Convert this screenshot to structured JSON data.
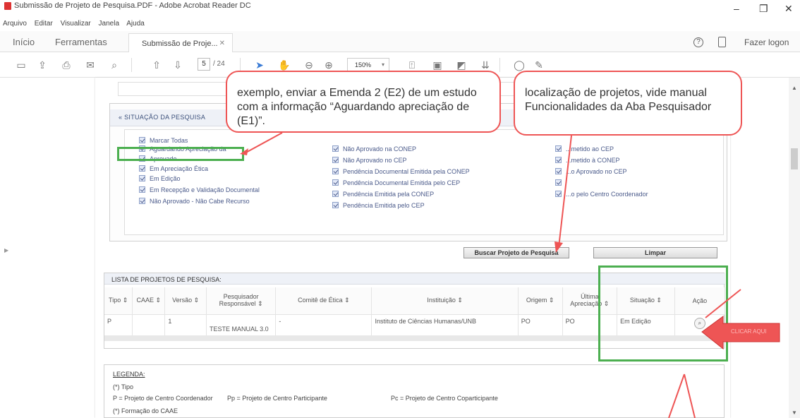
{
  "window": {
    "title": "Submissão de Projeto de Pesquisa.PDF - Adobe Acrobat Reader DC",
    "menu": [
      "Arquivo",
      "Editar",
      "Visualizar",
      "Janela",
      "Ajuda"
    ],
    "minimize": "–",
    "maximize": "❐",
    "close": "✕"
  },
  "tabs": {
    "home": "Início",
    "tools": "Ferramentas",
    "doc": "Submissão de Proje...",
    "close": "✕",
    "help": "?",
    "login": "Fazer logon"
  },
  "toolbar": {
    "page": "5",
    "page_count": "/ 24",
    "zoom": "150%"
  },
  "status_section": {
    "header": "SITUAÇÃO DA PESQUISA",
    "col1": [
      "Marcar Todas",
      "Aguardando Apreciação da",
      "Aprovado",
      "Em Apreciação Ética",
      "Em Edição",
      "Em Recepção e Validação Documental",
      "Não Aprovado - Não Cabe Recurso"
    ],
    "col2": [
      "Não Aprovado na CONEP",
      "Não Aprovado no CEP",
      "Pendência Documental Emitida pela CONEP",
      "Pendência Documental Emitida pelo CEP",
      "Pendência Emitida pela CONEP",
      "Pendência Emitida pelo CEP"
    ],
    "col3": [
      "...metido ao CEP",
      "...metido à CONEP",
      "...o Aprovado no CEP",
      "",
      "...o pelo Centro Coordenador"
    ],
    "search_btn": "Buscar Projeto de Pesquisa",
    "clear_btn": "Limpar"
  },
  "project_list": {
    "title": "LISTA DE PROJETOS DE PESQUISA:",
    "headers": [
      "Tipo ⇕",
      "CAAE ⇕",
      "Versão ⇕",
      "Pesquisador Responsável ⇕",
      "Comitê de Ética ⇕",
      "Instituição ⇕",
      "Origem ⇕",
      "Última Apreciação ⇕",
      "Situação ⇕",
      "Ação"
    ],
    "rows": [
      [
        "P",
        "",
        "1",
        "TESTE MANUAL 3.0",
        "-",
        "Instituto de Ciências Humanas/UNB",
        "PO",
        "PO",
        "Em Edição",
        ""
      ]
    ]
  },
  "legend": {
    "title": "LEGENDA:",
    "tipo": "(*) Tipo",
    "line1a": "P = Projeto de Centro Coordenador",
    "line1b": "Pp = Projeto de Centro Participante",
    "line1c": "Pc = Projeto de Centro Coparticipante",
    "caae": "(*) Formação do CAAE"
  },
  "annotations": {
    "callout_left": "exemplo, enviar a Emenda 2 (E2) de um estudo com a informação “Aguardando apreciação de (E1)”.",
    "callout_right": "localização de projetos, vide manual Funcionalidades da Aba Pesquisador",
    "arrow_label": "CLICAR AQUI"
  },
  "colors": {
    "highlight_green": "#4caf50",
    "annotation_red": "#e55",
    "checkbox_text": "#4a5a8a"
  }
}
